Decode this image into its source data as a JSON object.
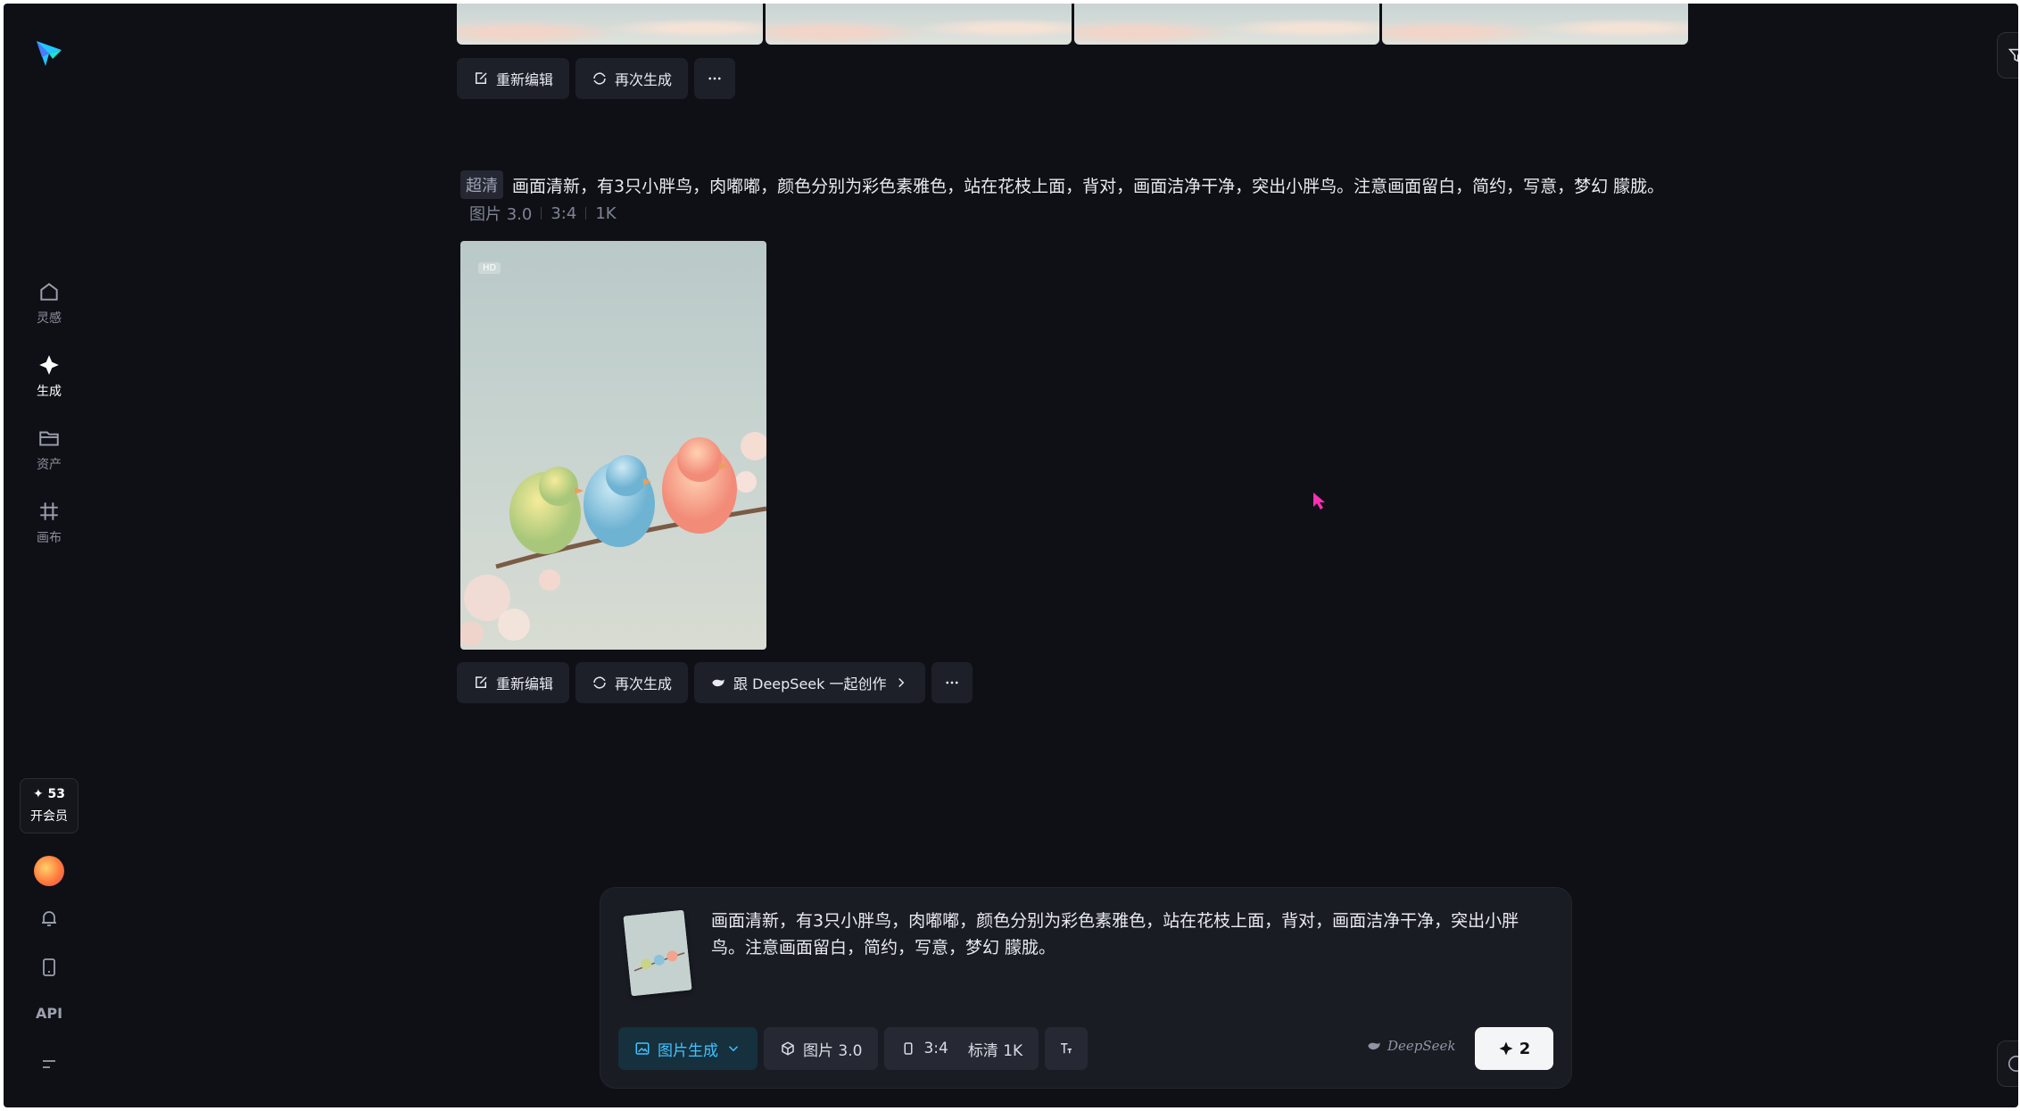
{
  "sidebar": {
    "nav": [
      {
        "label": "灵感",
        "icon": "home-icon"
      },
      {
        "label": "生成",
        "icon": "sparkle-icon"
      },
      {
        "label": "资产",
        "icon": "folder-icon"
      },
      {
        "label": "画布",
        "icon": "canvas-grid-icon"
      }
    ],
    "credits": "✦ 53",
    "vip_label": "开会员",
    "api_label": "API"
  },
  "actions": {
    "reedit": "重新编辑",
    "regenerate": "再次生成",
    "deepseek": "跟 DeepSeek 一起创作"
  },
  "record": {
    "quality_tag": "超清",
    "prompt": "画面清新，有3只小胖鸟，肉嘟嘟，颜色分别为彩色素雅色，站在花枝上面，背对，画面洁净干净，突出小胖鸟。注意画面留白，简约，写意，梦幻 朦胧。",
    "model": "图片 3.0",
    "ratio": "3:4",
    "resolution": "1K",
    "hd_badge": "HD"
  },
  "composer": {
    "text": "画面清新，有3只小胖鸟，肉嘟嘟，颜色分别为彩色素雅色，站在花枝上面，背对，画面洁净干净，突出小胖鸟。注意画面留白，简约，写意，梦幻 朦胧。",
    "mode": "图片生成",
    "model": "图片 3.0",
    "ratio": "3:4",
    "quality": "标清 1K",
    "deepseek_brand": "DeepSeek",
    "send_count": "2"
  },
  "colors": {
    "background": "#0f1016",
    "accent": "#3fc4ff",
    "button": "#1e2029"
  }
}
